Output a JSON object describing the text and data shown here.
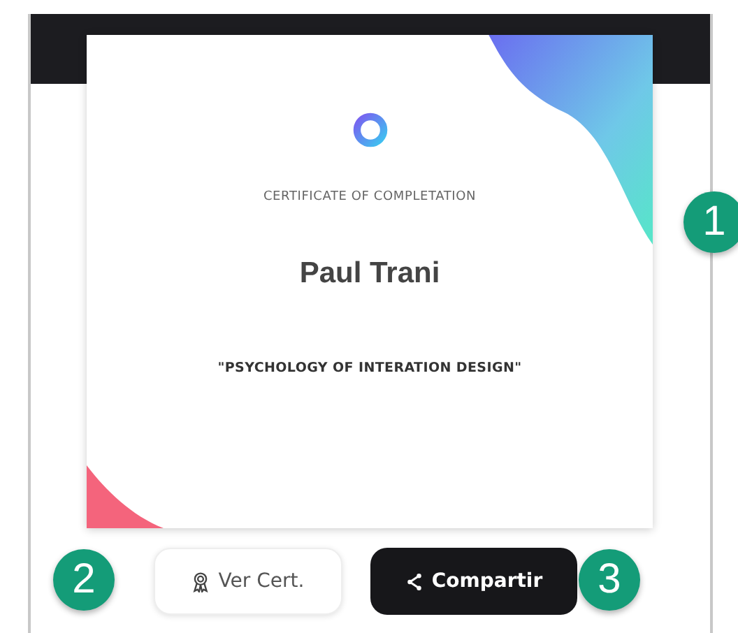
{
  "certificate": {
    "heading": "CERTIFICATE OF COMPLETATION",
    "recipient": "Paul Trani",
    "course": "\"PSYCHOLOGY OF INTERATION DESIGN\""
  },
  "buttons": [
    {
      "label": "Ver Cert.",
      "kind": "secondary"
    },
    {
      "label": "Compartir",
      "kind": "primary"
    }
  ],
  "callouts": [
    "1",
    "2",
    "3"
  ]
}
